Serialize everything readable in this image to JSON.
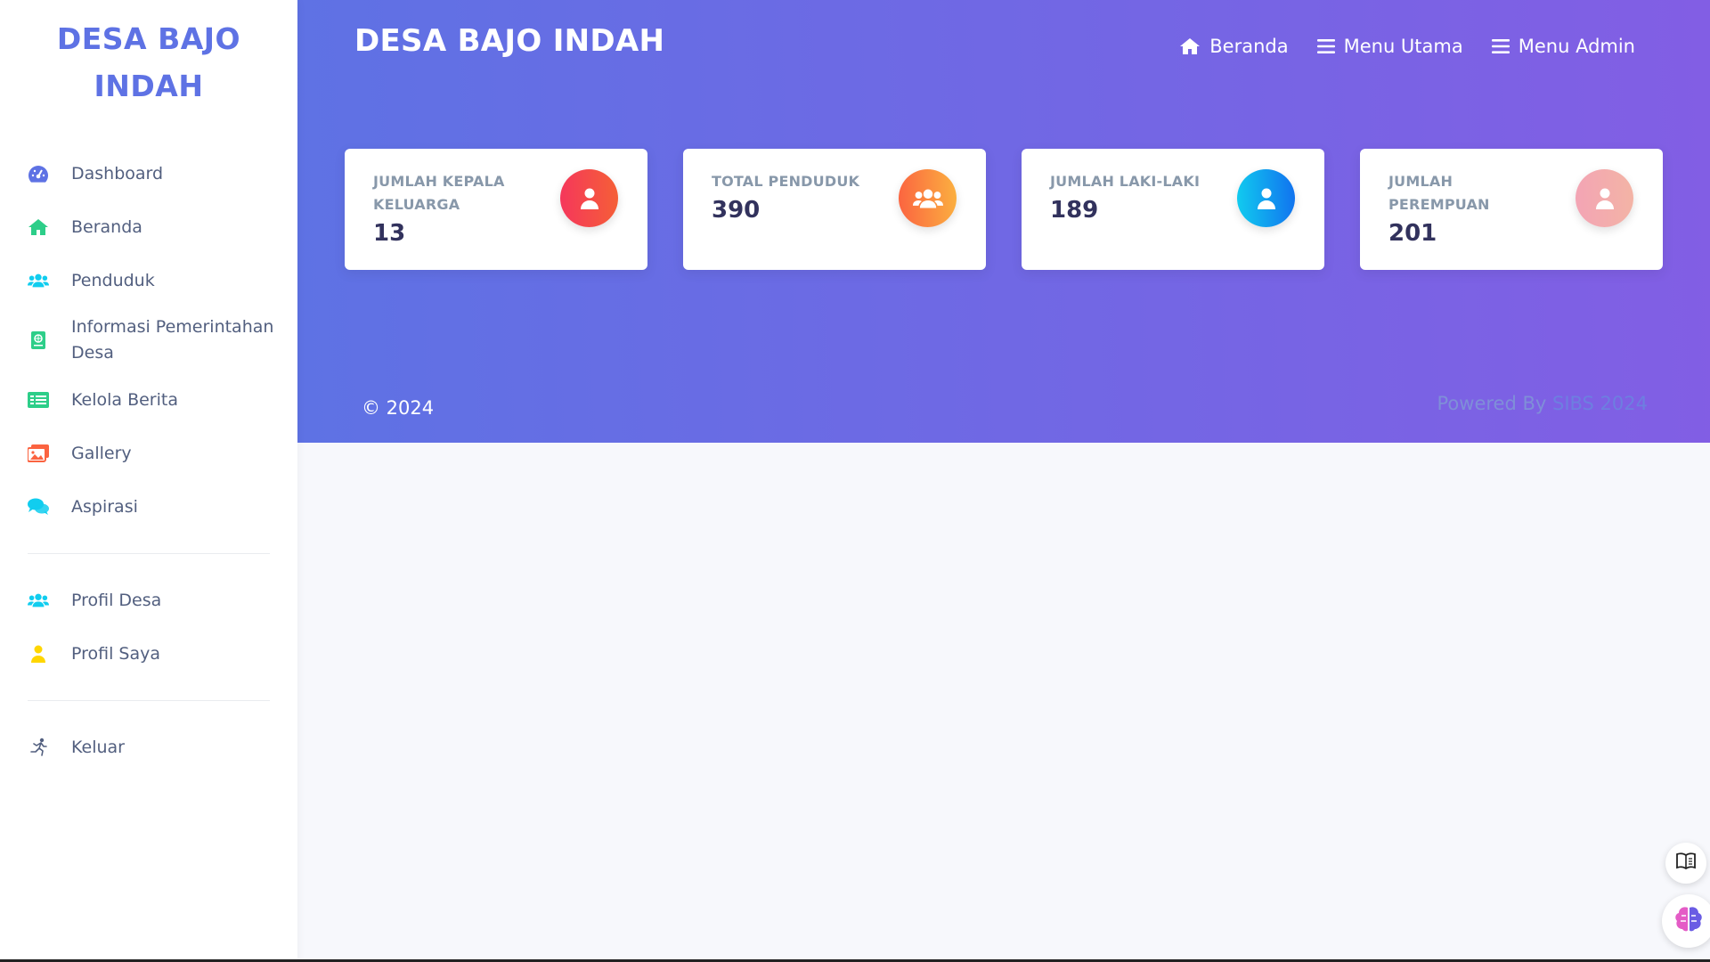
{
  "sidebar": {
    "brand_line1": "DESA BAJO",
    "brand_line2": "INDAH",
    "items": [
      {
        "label": "Dashboard",
        "icon": "dashboard-gauge-icon",
        "color": "#5e72e4"
      },
      {
        "label": "Beranda",
        "icon": "home-icon",
        "color": "#2dce89"
      },
      {
        "label": "Penduduk",
        "icon": "users-icon",
        "color": "#11cdef"
      },
      {
        "label": "Informasi Pemerintahan Desa",
        "icon": "info-book-icon",
        "color": "#2dce89"
      },
      {
        "label": "Kelola Berita",
        "icon": "news-list-icon",
        "color": "#2dce89"
      },
      {
        "label": "Gallery",
        "icon": "images-icon",
        "color": "#fb6340"
      },
      {
        "label": "Aspirasi",
        "icon": "comments-icon",
        "color": "#11cdef"
      }
    ],
    "items2": [
      {
        "label": "Profil Desa",
        "icon": "users-icon",
        "color": "#11cdef"
      },
      {
        "label": "Profil Saya",
        "icon": "user-icon",
        "color": "#ffd600"
      }
    ],
    "items3": [
      {
        "label": "Keluar",
        "icon": "running-exit-icon",
        "color": "#525f7f"
      }
    ]
  },
  "header": {
    "title": "DESA BAJO INDAH",
    "nav": [
      {
        "label": "Beranda",
        "icon": "home-icon"
      },
      {
        "label": "Menu Utama",
        "icon": "hamburger-icon"
      },
      {
        "label": "Menu Admin",
        "icon": "hamburger-icon"
      }
    ]
  },
  "cards": [
    {
      "title": "JUMLAH KEPALA KELUARGA",
      "value": "13",
      "icon": "user-icon",
      "color": "#f5365c"
    },
    {
      "title": "TOTAL PENDUDUK",
      "value": "390",
      "icon": "users-icon",
      "color": "#fb6340"
    },
    {
      "title": "JUMLAH LAKI-LAKI",
      "value": "189",
      "icon": "user-icon",
      "color": "#11cdef"
    },
    {
      "title": "JUMLAH PEREMPUAN",
      "value": "201",
      "icon": "user-icon",
      "color": "#f3a4b5"
    }
  ],
  "footer": {
    "copyright": "© 2024",
    "powered_by": "Powered By",
    "powered_who": "SIBS 2024"
  },
  "floating": {
    "reader_icon": "book-reader-icon",
    "assistant_icon": "brain-icon"
  },
  "colors": {
    "accent": "#5e72e4",
    "gradient_start": "#5e72e4",
    "gradient_end": "#825ee4"
  }
}
